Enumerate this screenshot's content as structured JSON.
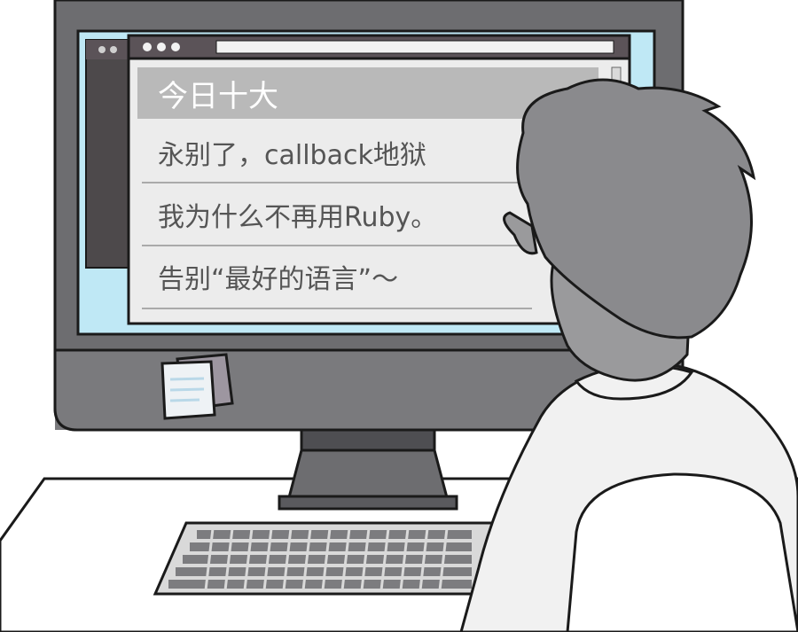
{
  "browser_window": {
    "headlines": [
      "今日十大",
      "永别了，callback地狱",
      "我为什么不再用Ruby。",
      "告别“最好的语言”～"
    ]
  },
  "colors": {
    "monitor_body": "#6d6d70",
    "monitor_outline": "#1a1a1a",
    "screen_bg": "#bfe8f5",
    "window_chrome": "#5b5358",
    "window_bg": "#ececec",
    "header_row": "#b9b9b9",
    "hair": "#8a8a8d",
    "skin": "#9a9a9c",
    "shirt": "#f1f1f1"
  },
  "icons": [
    "window-dots-icon",
    "sticky-note-icon"
  ]
}
